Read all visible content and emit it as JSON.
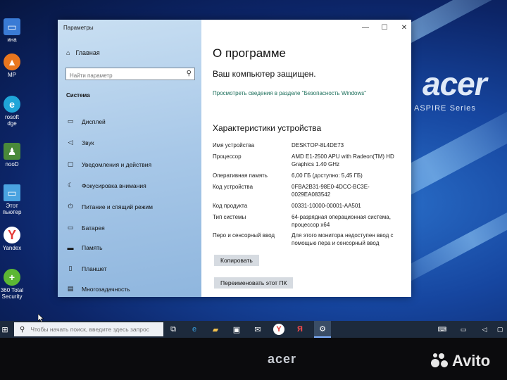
{
  "desktop": {
    "brand": "acer",
    "brand_sub_a": "ASPIRE",
    "brand_sub_b": "Series",
    "icons": [
      {
        "label": "ина",
        "icon": "window-icon",
        "color": "#3a7bd5"
      },
      {
        "label": "MP",
        "icon": "aimp-icon",
        "color": "#e8761e"
      },
      {
        "label": "rosoft\ndge",
        "icon": "edge-icon",
        "color": "#1fa5d8"
      },
      {
        "label": "nooD",
        "icon": "app-icon",
        "color": "#4a8a3a"
      },
      {
        "label": "Этот\nпьютер",
        "icon": "computer-icon",
        "color": "#4aa3e0"
      },
      {
        "label": "Yandex",
        "icon": "yandex-icon",
        "color": "#e53935"
      },
      {
        "label": "360 Total\nSecurity",
        "icon": "shield-icon",
        "color": "#5cb734"
      }
    ]
  },
  "window": {
    "title": "Параметры",
    "controls": {
      "minimize": "—",
      "maximize": "☐",
      "close": "✕"
    },
    "sidebar": {
      "home_label": "Главная",
      "search_placeholder": "Найти параметр",
      "section_label": "Система",
      "items": [
        {
          "label": "Дисплей",
          "icon": "display-icon"
        },
        {
          "label": "Звук",
          "icon": "sound-icon"
        },
        {
          "label": "Уведомления и действия",
          "icon": "notifications-icon"
        },
        {
          "label": "Фокусировка внимания",
          "icon": "focus-icon"
        },
        {
          "label": "Питание и спящий режим",
          "icon": "power-icon"
        },
        {
          "label": "Батарея",
          "icon": "battery-icon"
        },
        {
          "label": "Память",
          "icon": "storage-icon"
        },
        {
          "label": "Планшет",
          "icon": "tablet-icon"
        },
        {
          "label": "Многозадачность",
          "icon": "multitask-icon"
        }
      ]
    },
    "main": {
      "page_title": "О программе",
      "protected_text": "Ваш компьютер защищен.",
      "security_link": "Просмотреть сведения в разделе \"Безопасность Windows\"",
      "specs_title": "Характеристики устройства",
      "specs": [
        {
          "key": "Имя устройства",
          "value": "DESKTOP-8L4DE73"
        },
        {
          "key": "Процессор",
          "value": "AMD E1-2500 APU with Radeon(TM) HD Graphics      1.40 GHz"
        },
        {
          "key": "Оперативная память",
          "value": "6,00 ГБ (доступно: 5,45 ГБ)"
        },
        {
          "key": "Код устройства",
          "value": "0FBA2B31-98E0-4DCC-BC3E-0029EA083542"
        },
        {
          "key": "Код продукта",
          "value": "00331-10000-00001-AA501"
        },
        {
          "key": "Тип системы",
          "value": "64-разрядная операционная система, процессор x64"
        },
        {
          "key": "Перо и сенсорный ввод",
          "value": "Для этого монитора недоступен ввод с помощью пера и сенсорный ввод"
        }
      ],
      "copy_button": "Копировать",
      "rename_button": "Переименовать этот ПК"
    }
  },
  "taskbar": {
    "search_placeholder": "Чтобы начать поиск, введите здесь запрос",
    "icons": [
      "task-view-icon",
      "edge-icon",
      "file-explorer-icon",
      "store-icon",
      "mail-icon",
      "yandex-browser-icon",
      "yandex-icon",
      "settings-icon"
    ]
  },
  "bezel": {
    "logo": "acer",
    "watermark": "Avito"
  }
}
